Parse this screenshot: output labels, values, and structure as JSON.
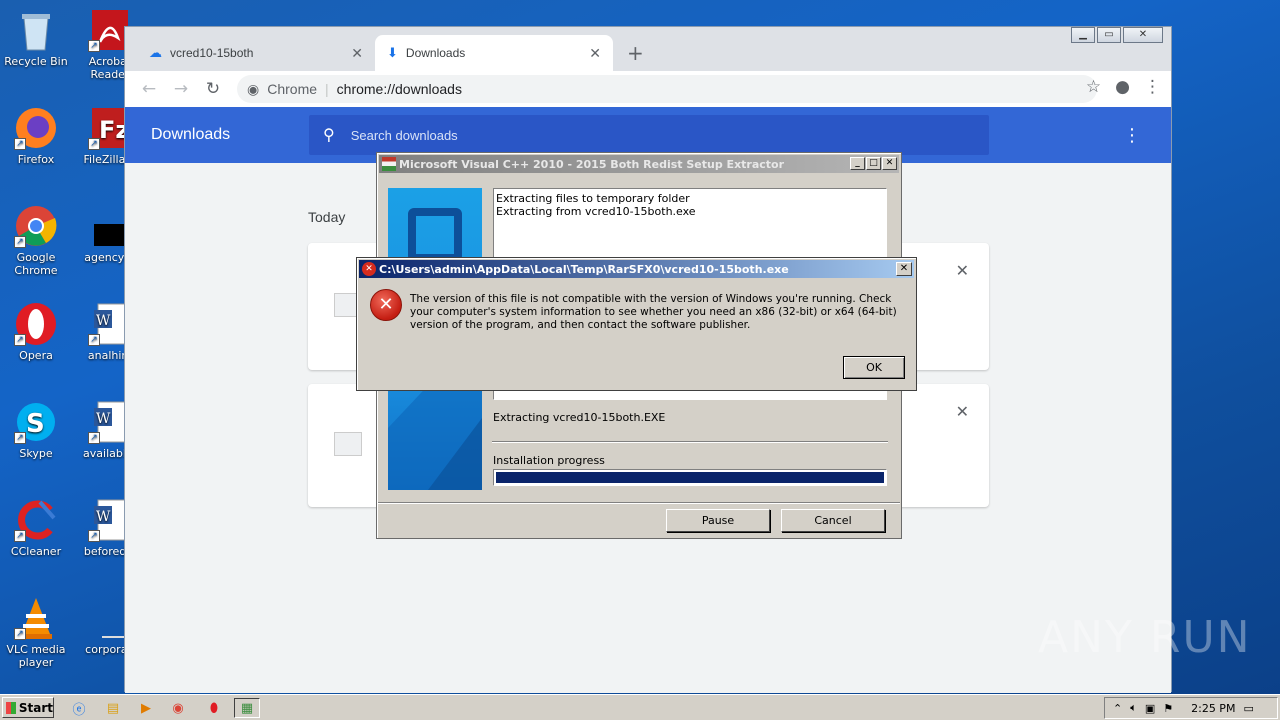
{
  "desktop": {
    "icons": [
      {
        "label": "Recycle Bin",
        "icon": "recycle-bin-icon"
      },
      {
        "label": "Acrobat Reader",
        "icon": "acrobat-icon"
      },
      {
        "label": "Firefox",
        "icon": "firefox-icon"
      },
      {
        "label": "FileZilla C",
        "icon": "filezilla-icon"
      },
      {
        "label": "Google Chrome",
        "icon": "chrome-icon"
      },
      {
        "label": "agencybr",
        "icon": "black-file-icon"
      },
      {
        "label": "Opera",
        "icon": "opera-icon"
      },
      {
        "label": "analhim",
        "icon": "word-doc-icon"
      },
      {
        "label": "Skype",
        "icon": "skype-icon"
      },
      {
        "label": "availablet",
        "icon": "word-doc-icon"
      },
      {
        "label": "CCleaner",
        "icon": "ccleaner-icon"
      },
      {
        "label": "beforedoi",
        "icon": "word-doc-icon"
      },
      {
        "label": "VLC media player",
        "icon": "vlc-icon"
      },
      {
        "label": "corporati",
        "icon": "file-icon"
      }
    ]
  },
  "browser": {
    "tabs": [
      {
        "label": "vcred10-15both",
        "icon": "cloud-icon",
        "active": false
      },
      {
        "label": "Downloads",
        "icon": "download-icon",
        "active": true
      }
    ],
    "omnibox": {
      "site": "Chrome",
      "url": "chrome://downloads"
    },
    "page": {
      "title": "Downloads",
      "search_placeholder": "Search downloads",
      "section_label": "Today"
    }
  },
  "extractor": {
    "title": "Microsoft Visual C++ 2010 - 2015 Both Redist Setup Extractor",
    "log_lines": [
      "Extracting files to temporary folder",
      "Extracting from vcred10-15both.exe"
    ],
    "status": "Extracting vcred10-15both.EXE",
    "progress_label": "Installation progress",
    "progress_value": 1.0,
    "buttons": {
      "pause": "Pause",
      "cancel": "Cancel"
    }
  },
  "error_dialog": {
    "title": "C:\\Users\\admin\\AppData\\Local\\Temp\\RarSFX0\\vcred10-15both.exe",
    "message": "The version of this file is not compatible with the version of Windows you're running. Check your computer's system information to see whether you need an x86 (32-bit) or x64 (64-bit) version of the program, and then contact the software publisher.",
    "ok_label": "OK"
  },
  "taskbar": {
    "start_label": "Start",
    "clock": "2:25 PM"
  },
  "watermark": "ANY RUN"
}
